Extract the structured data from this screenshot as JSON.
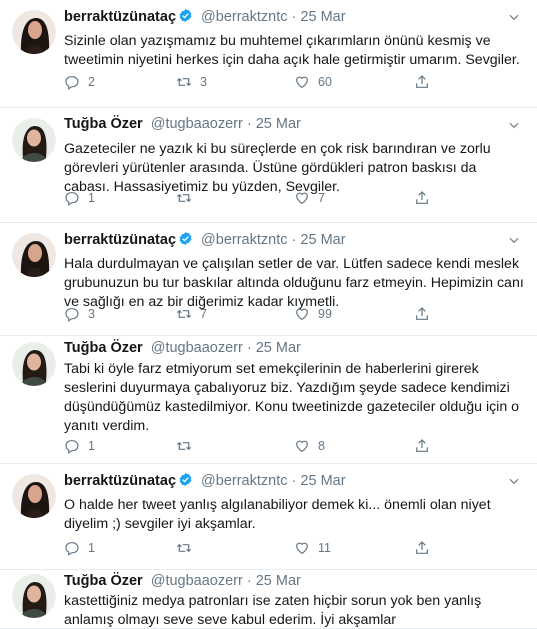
{
  "tweets": [
    {
      "name": "berraktüzünataç",
      "verified": true,
      "handle": "@berraktzntc",
      "date": "25 Mar",
      "text": "Sizinle olan yazışmamız bu muhtemel çıkarımların önünü kesmiş ve tweetimin niyetini herkes için daha açık hale getirmiştir umarım. Sevgiler.",
      "replies": "2",
      "retweets": "3",
      "likes": "60"
    },
    {
      "name": "Tuğba Özer",
      "verified": false,
      "handle": "@tugbaaozerr",
      "date": "25 Mar",
      "text": "Gazeteciler ne yazık ki bu süreçlerde en çok risk barındıran ve zorlu görevleri yürütenler arasında. Üstüne gördükleri patron baskısı da cabası. Hassasiyetimiz bu yüzden, Sevgiler.",
      "replies": "1",
      "retweets": "",
      "likes": "7"
    },
    {
      "name": "berraktüzünataç",
      "verified": true,
      "handle": "@berraktzntc",
      "date": "25 Mar",
      "text": "Hala durdulmayan ve çalışılan setler de var. Lütfen sadece kendi meslek grubunuzun bu tur baskılar altında olduğunu farz etmeyin. Hepimizin canı ve sağlığı en az bir diğerimiz kadar kıymetli.",
      "replies": "3",
      "retweets": "7",
      "likes": "99"
    },
    {
      "name": "Tuğba Özer",
      "verified": false,
      "handle": "@tugbaaozerr",
      "date": "25 Mar",
      "text": "Tabi ki öyle farz etmiyorum set emekçilerinin de haberlerini girerek seslerini duyurmaya çabalıyoruz biz. Yazdığım şeyde sadece kendimizi düşündüğümüz kastedilmiyor. Konu tweetinizde gazeteciler olduğu için o yanıtı verdim.",
      "replies": "1",
      "retweets": "",
      "likes": "8"
    },
    {
      "name": "berraktüzünataç",
      "verified": true,
      "handle": "@berraktzntc",
      "date": "25 Mar",
      "text": "O halde her tweet yanlış  algılanabiliyor  demek ki... önemli olan niyet diyelim ;) sevgiler iyi akşamlar.",
      "replies": "1",
      "retweets": "",
      "likes": "11"
    },
    {
      "name": "Tuğba Özer",
      "verified": false,
      "handle": "@tugbaaozerr",
      "date": "25 Mar",
      "text": "kastettiğiniz medya patronları ise zaten hiçbir sorun yok ben yanlış anlamış olmayı seve seve kabul ederim. İyi akşamlar",
      "replies": "",
      "retweets": "",
      "likes": ""
    }
  ],
  "colors": {
    "text": "#14171a",
    "muted": "#657786",
    "verified": "#1da1f2",
    "divider": "#e6ecf0"
  },
  "icons": {
    "reply": "reply-icon",
    "retweet": "retweet-icon",
    "like": "heart-icon",
    "share": "share-icon",
    "verified": "verified-badge-icon",
    "more": "chevron-down-icon"
  }
}
